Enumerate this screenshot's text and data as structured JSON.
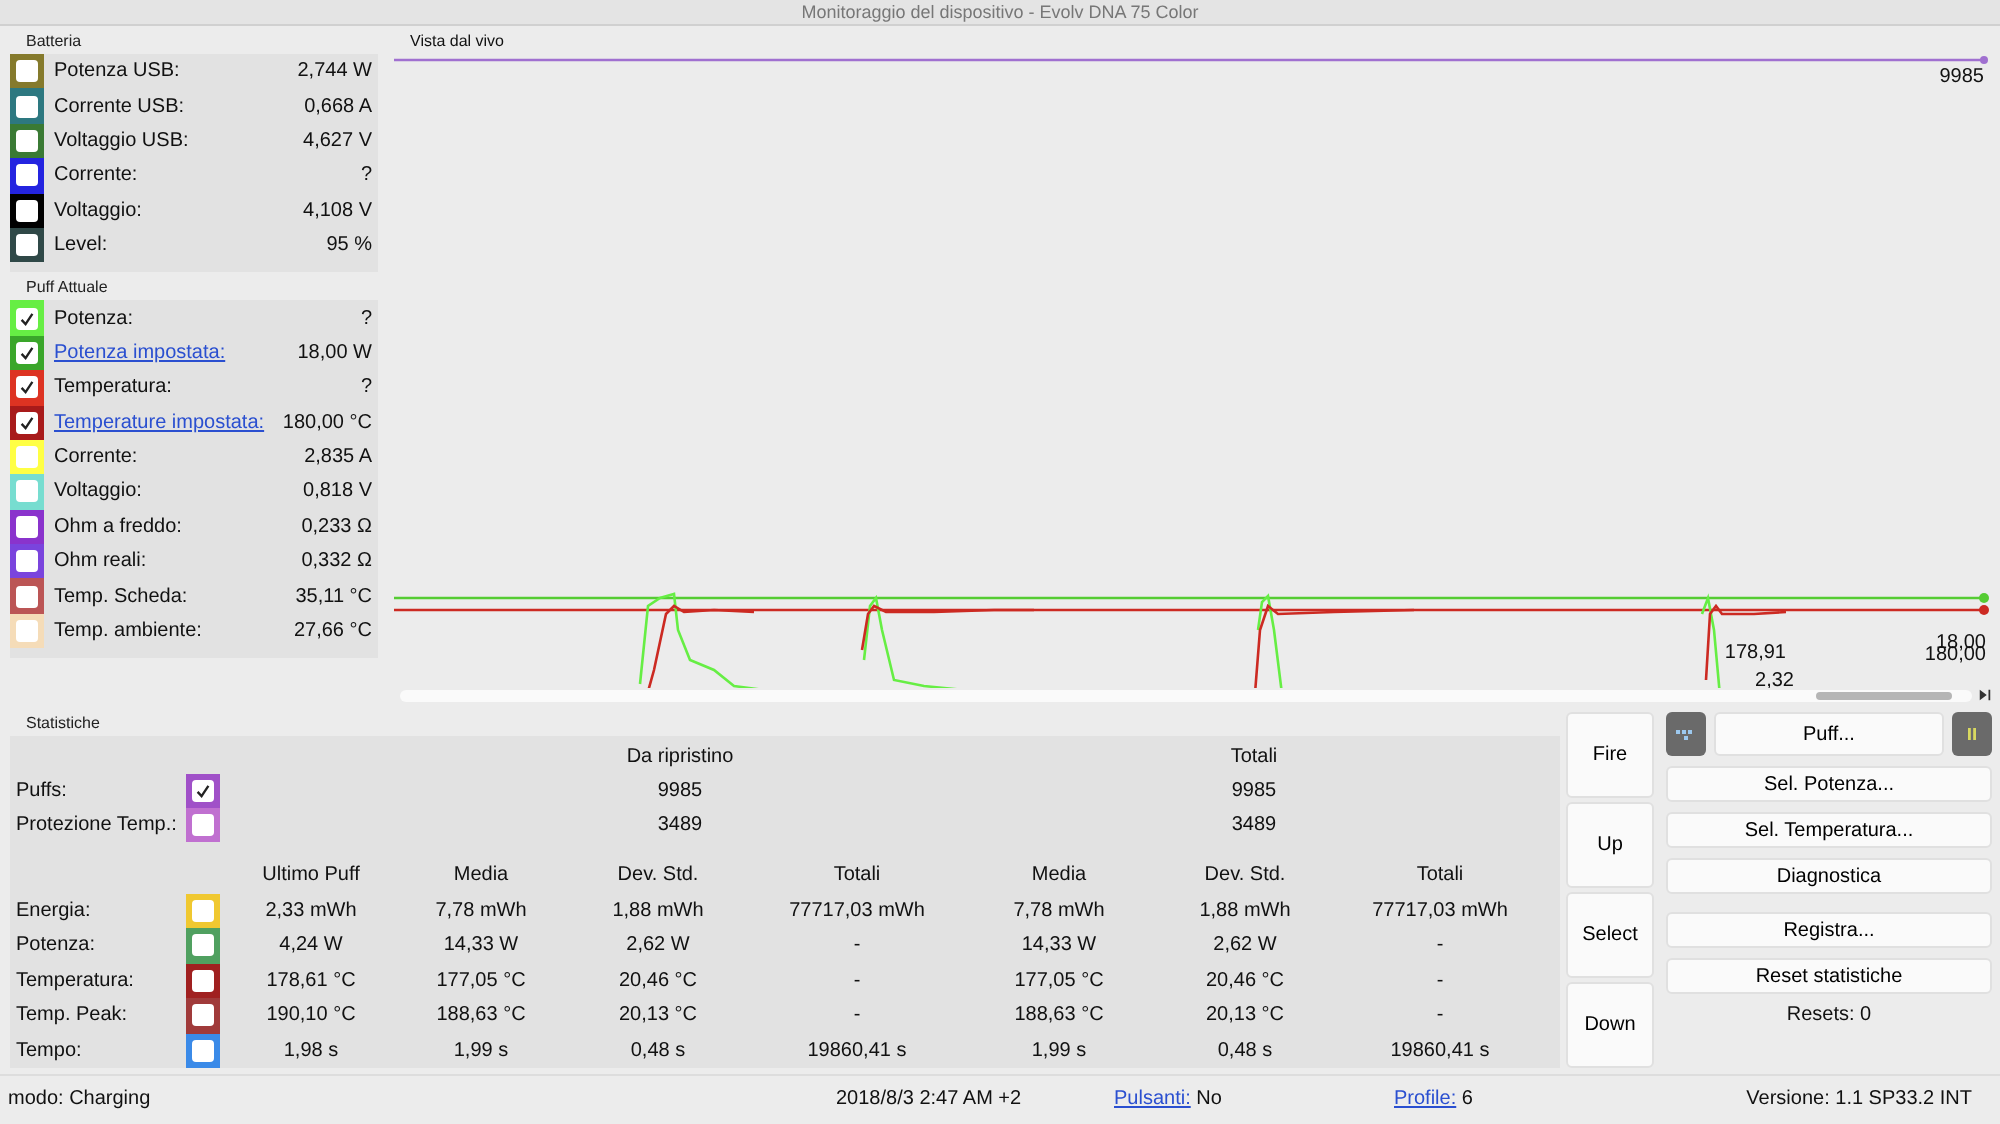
{
  "window": {
    "title": "Monitoraggio del dispositivo - Evolv DNA 75 Color"
  },
  "battery": {
    "title": "Batteria",
    "items": [
      {
        "label": "Potenza USB:",
        "value": "2,744 W",
        "color": "#857a2c",
        "checked": false,
        "link": false
      },
      {
        "label": "Corrente USB:",
        "value": "0,668 A",
        "color": "#2d7880",
        "checked": false,
        "link": false
      },
      {
        "label": "Voltaggio USB:",
        "value": "4,627 V",
        "color": "#3a7a34",
        "checked": false,
        "link": false
      },
      {
        "label": "Corrente:",
        "value": "?",
        "color": "#2424e0",
        "checked": false,
        "link": false
      },
      {
        "label": "Voltaggio:",
        "value": "4,108 V",
        "color": "#000000",
        "checked": false,
        "link": false
      },
      {
        "label": "Level:",
        "value": "95 %",
        "color": "#2f4847",
        "checked": false,
        "link": false
      }
    ]
  },
  "puff": {
    "title": "Puff Attuale",
    "items": [
      {
        "label": "Potenza:",
        "value": "?",
        "color": "#66ee44",
        "checked": true,
        "link": false
      },
      {
        "label": "Potenza impostata:",
        "value": "18,00 W",
        "color": "#3aa62a",
        "checked": true,
        "link": true
      },
      {
        "label": "Temperatura:",
        "value": "?",
        "color": "#dd3322",
        "checked": true,
        "link": false
      },
      {
        "label": "Temperature impostata:",
        "value": "180,00 °C",
        "color": "#a81a1a",
        "checked": true,
        "link": true
      },
      {
        "label": "Corrente:",
        "value": "2,835 A",
        "color": "#ffff44",
        "checked": false,
        "link": false
      },
      {
        "label": "Voltaggio:",
        "value": "0,818 V",
        "color": "#77ddd0",
        "checked": false,
        "link": false
      },
      {
        "label": "Ohm a freddo:",
        "value": "0,233 Ω",
        "color": "#8a33cc",
        "checked": false,
        "link": false
      },
      {
        "label": "Ohm reali:",
        "value": "0,332 Ω",
        "color": "#7a44dd",
        "checked": false,
        "link": false
      },
      {
        "label": "Temp. Scheda:",
        "value": "35,11 °C",
        "color": "#bb5555",
        "checked": false,
        "link": false
      },
      {
        "label": "Temp. ambiente:",
        "value": "27,66 °C",
        "color": "#f5dcb8",
        "checked": false,
        "link": false
      }
    ]
  },
  "live": {
    "title": "Vista dal vivo",
    "labels": [
      "9985",
      "178,91",
      "18,00",
      "180,00",
      "2,32"
    ]
  },
  "stats": {
    "title": "Statistiche",
    "group_headers": [
      "Da ripristino",
      "Totali"
    ],
    "counters": [
      {
        "label": "Puffs:",
        "color": "#a050c8",
        "checked": true,
        "since_reset": "9985",
        "total": "9985"
      },
      {
        "label": "Protezione Temp.:",
        "color": "#c070d0",
        "checked": false,
        "since_reset": "3489",
        "total": "3489"
      }
    ],
    "columns": [
      "Ultimo Puff",
      "Media",
      "Dev. Std.",
      "Totali",
      "Media",
      "Dev. Std.",
      "Totali"
    ],
    "rows": [
      {
        "label": "Energia:",
        "color": "#f0c830",
        "checked": false,
        "cells": [
          "2,33 mWh",
          "7,78 mWh",
          "1,88 mWh",
          "77717,03 mWh",
          "7,78 mWh",
          "1,88 mWh",
          "77717,03 mWh"
        ]
      },
      {
        "label": "Potenza:",
        "color": "#50a060",
        "checked": false,
        "cells": [
          "4,24 W",
          "14,33 W",
          "2,62 W",
          "-",
          "14,33 W",
          "2,62 W",
          "-"
        ]
      },
      {
        "label": "Temperatura:",
        "color": "#a02020",
        "checked": false,
        "cells": [
          "178,61 °C",
          "177,05 °C",
          "20,46 °C",
          "-",
          "177,05 °C",
          "20,46 °C",
          "-"
        ]
      },
      {
        "label": "Temp. Peak:",
        "color": "#a03a3a",
        "checked": false,
        "cells": [
          "190,10 °C",
          "188,63 °C",
          "20,13 °C",
          "-",
          "188,63 °C",
          "20,13 °C",
          "-"
        ]
      },
      {
        "label": "Tempo:",
        "color": "#3a8ae8",
        "checked": false,
        "cells": [
          "1,98 s",
          "1,99 s",
          "0,48 s",
          "19860,41 s",
          "1,99 s",
          "0,48 s",
          "19860,41 s"
        ]
      }
    ]
  },
  "device_buttons": [
    "Fire",
    "Up",
    "Select",
    "Down"
  ],
  "puff_button": "Puff...",
  "actions": [
    "Sel. Potenza...",
    "Sel. Temperatura...",
    "Diagnostica",
    "Registra...",
    "Reset statistiche"
  ],
  "resets": "Resets: 0",
  "status_bar": {
    "mode": "modo: Charging",
    "datetime": "2018/8/3 2:47 AM +2",
    "buttons_link": "Pulsanti:",
    "buttons_value": "No",
    "profile_link": "Profile:",
    "profile_value": "6",
    "version": "Versione: 1.1 SP33.2 INT"
  }
}
